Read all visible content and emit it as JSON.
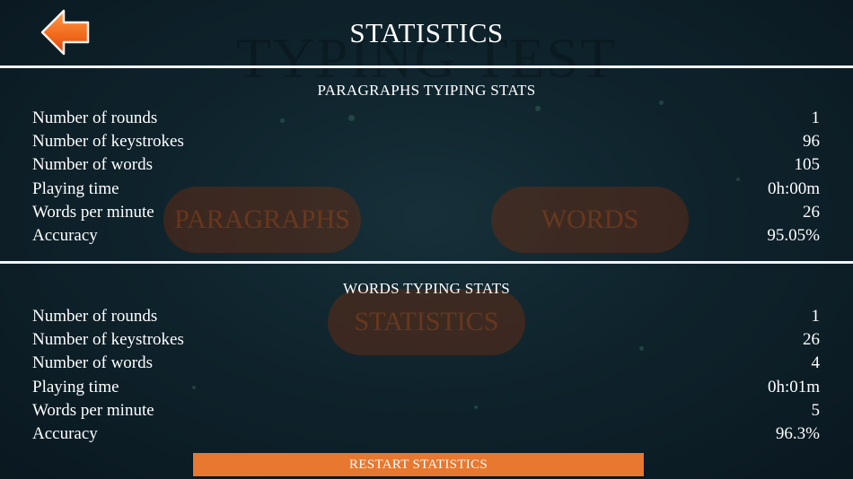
{
  "header": {
    "title": "STATISTICS",
    "back_icon": "back-arrow-icon",
    "back_icon_color": "#f26b1d"
  },
  "background": {
    "title": "TYPING TEST",
    "menu": {
      "paragraphs": "PARAGRAPHS",
      "words": "WORDS",
      "statistics": "STATISTICS"
    }
  },
  "sections": [
    {
      "title": "PARAGRAPHS TYIPING STATS",
      "rows": [
        {
          "label": "Number of rounds",
          "value": "1"
        },
        {
          "label": "Number of keystrokes",
          "value": "96"
        },
        {
          "label": "Number of words",
          "value": "105"
        },
        {
          "label": "Playing time",
          "value": "0h:00m"
        },
        {
          "label": "Words per minute",
          "value": "26"
        },
        {
          "label": "Accuracy",
          "value": "95.05%"
        }
      ]
    },
    {
      "title": "WORDS TYPING STATS",
      "rows": [
        {
          "label": "Number of rounds",
          "value": "1"
        },
        {
          "label": "Number of keystrokes",
          "value": "26"
        },
        {
          "label": "Number of words",
          "value": "4"
        },
        {
          "label": "Playing time",
          "value": "0h:01m"
        },
        {
          "label": "Words per minute",
          "value": "5"
        },
        {
          "label": "Accuracy",
          "value": "96.3%"
        }
      ]
    }
  ],
  "restart_button": {
    "label": "RESTART STATISTICS",
    "color": "#e8782f"
  }
}
